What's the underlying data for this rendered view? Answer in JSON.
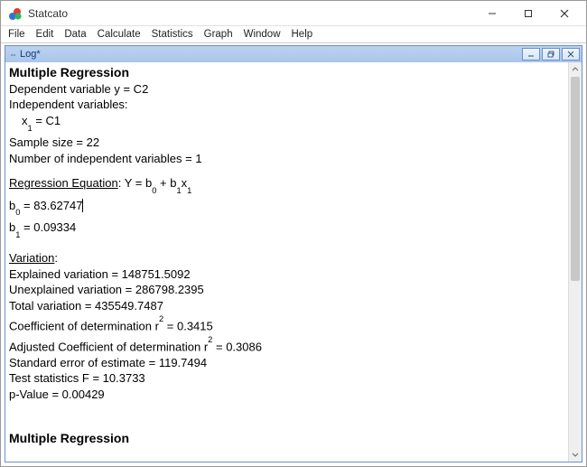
{
  "window": {
    "title": "Statcato"
  },
  "menu": {
    "file": "File",
    "edit": "Edit",
    "data": "Data",
    "calculate": "Calculate",
    "statistics": "Statistics",
    "graph": "Graph",
    "window": "Window",
    "help": "Help"
  },
  "log_window": {
    "title": "Log*"
  },
  "content": {
    "heading1": "Multiple Regression",
    "dep_var_line": "Dependent variable y = C2",
    "indep_vars_label": "Independent variables:",
    "indep_var1_label": "x",
    "indep_var1_sub": "1",
    "indep_var1_eq": " = C1",
    "sample_size_line": "Sample size = 22",
    "num_indep_line": "Number of independent variables = 1",
    "eq_label": "Regression Equation",
    "eq_colon": ": Y = b",
    "eq_b0_sub": "0",
    "eq_plus": " + b",
    "eq_b1_sub": "1",
    "eq_x": "x",
    "eq_x_sub": "1",
    "b0_label": "b",
    "b0_sub": "0",
    "b0_val": " = 83.62747",
    "b1_label": "b",
    "b1_sub": "1",
    "b1_val": " = 0.09334",
    "variation_label": "Variation",
    "variation_colon": ":",
    "explained_var": "Explained variation = 148751.5092",
    "unexplained_var": "Unexplained variation = 286798.2395",
    "total_var": "Total variation = 435549.7487",
    "coef_det_pre": "Coefficient of determination r",
    "coef_det_sup": "2",
    "coef_det_val": " = 0.3415",
    "adj_coef_det_pre": "Adjusted Coefficient of determination r",
    "adj_coef_det_sup": "2",
    "adj_coef_det_val": " = 0.3086",
    "std_err": "Standard error of estimate = 119.7494",
    "fstat": "Test statistics F = 10.3733",
    "pval": "p-Value = 0.00429",
    "heading2": "Multiple Regression"
  },
  "chart_data": {
    "type": "table",
    "title": "Multiple Regression",
    "dependent_variable": "C2",
    "independent_variables": [
      "C1"
    ],
    "sample_size": 22,
    "num_independent_variables": 1,
    "regression_equation": "Y = b0 + b1*x1",
    "coefficients": {
      "b0": 83.62747,
      "b1": 0.09334
    },
    "variation": {
      "explained": 148751.5092,
      "unexplained": 286798.2395,
      "total": 435549.7487
    },
    "coefficient_of_determination_r2": 0.3415,
    "adjusted_r2": 0.3086,
    "standard_error_of_estimate": 119.7494,
    "f_statistic": 10.3733,
    "p_value": 0.00429
  }
}
